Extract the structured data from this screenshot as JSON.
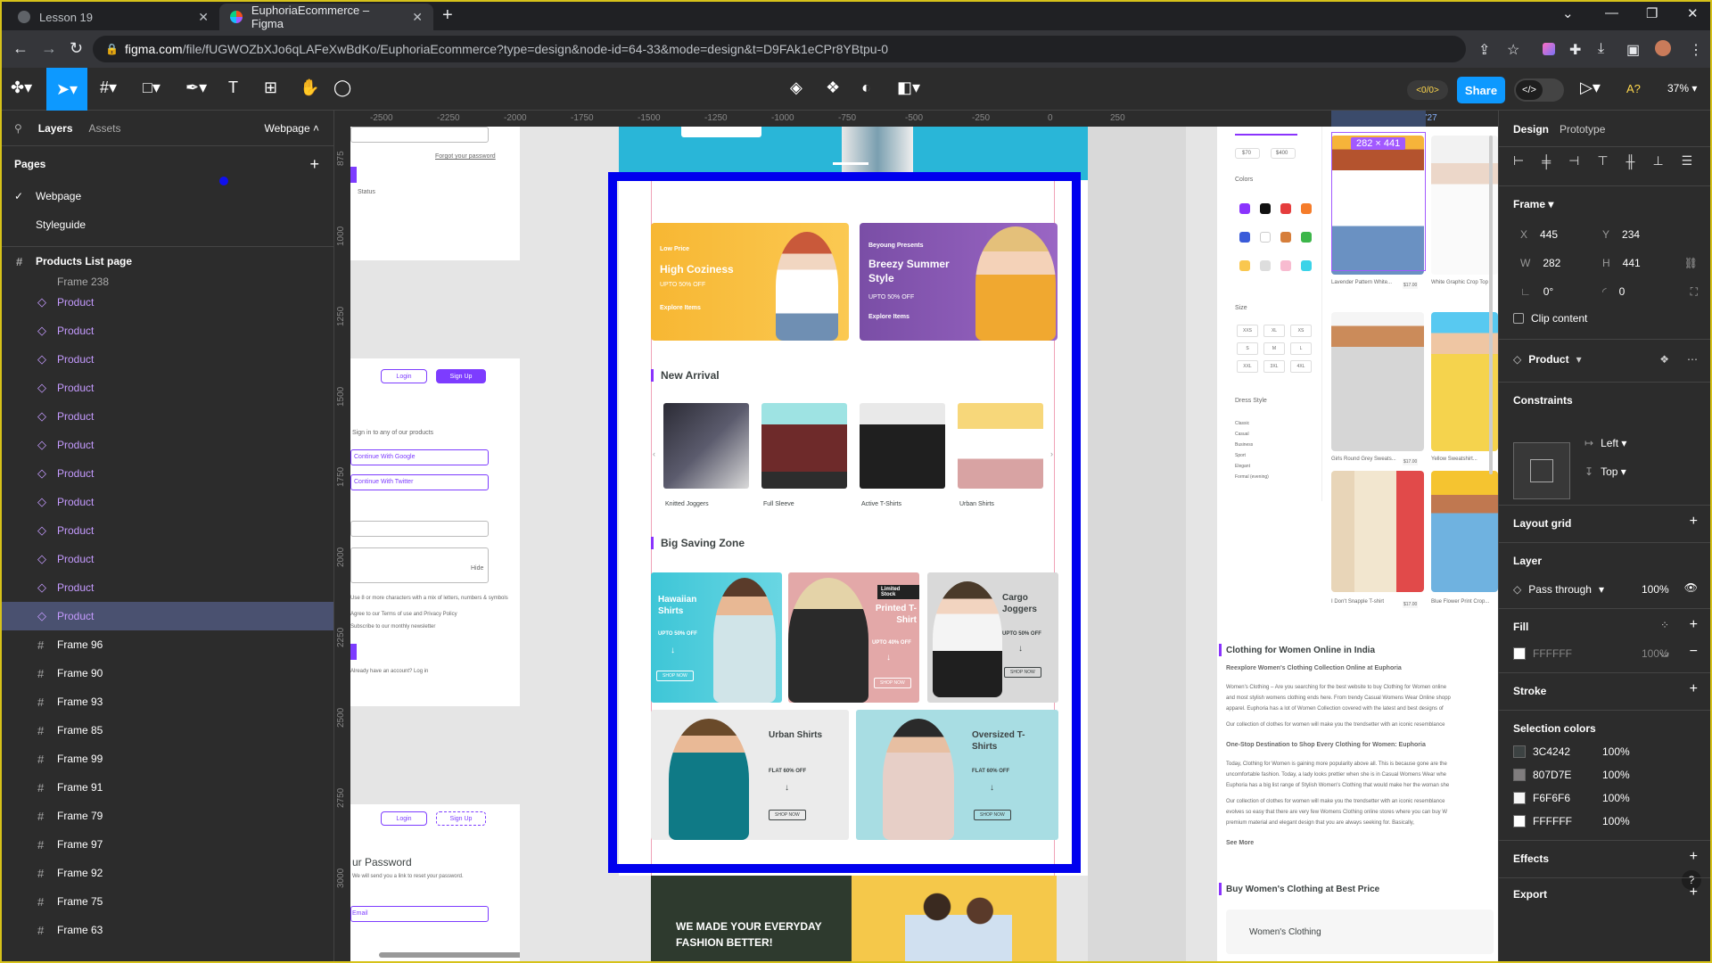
{
  "browser": {
    "tabs": [
      {
        "title": "Lesson 19"
      },
      {
        "title": "EuphoriaEcommerce – Figma"
      }
    ],
    "url_host": "figma.com",
    "url_path": "/file/fUGWOZbXJo6qLAFeXwBdKo/EuphoriaEcommerce?type=design&node-id=64-33&mode=design&t=D9FAk1eCPr8YBtpu-0"
  },
  "toolbar": {
    "share_label": "Share",
    "zoom": "37%",
    "multiplayer_label": "<0/0>",
    "code_label": "</>"
  },
  "left_panel": {
    "tabs": [
      "Layers",
      "Assets"
    ],
    "page_selector": "Webpage",
    "pages_heading": "Pages",
    "pages": [
      {
        "name": "Webpage",
        "current": true
      },
      {
        "name": "Styleguide",
        "current": false
      }
    ],
    "top_frame": "Products List page",
    "partial_row": "Frame 238",
    "components": [
      "Product",
      "Product",
      "Product",
      "Product",
      "Product",
      "Product",
      "Product",
      "Product",
      "Product",
      "Product",
      "Product",
      "Product"
    ],
    "frames": [
      "Frame 96",
      "Frame 90",
      "Frame 93",
      "Frame 85",
      "Frame 99",
      "Frame 91",
      "Frame 79",
      "Frame 97",
      "Frame 92",
      "Frame 75",
      "Frame 63"
    ]
  },
  "rulers": {
    "top": [
      "-2500",
      "-2250",
      "-2000",
      "-1750",
      "-1500",
      "-1250",
      "-1000",
      "-750",
      "-500",
      "-250",
      "0",
      "250",
      "445",
      "727"
    ],
    "left": [
      "875",
      "1000",
      "1250",
      "1500",
      "1750",
      "2000",
      "2250",
      "2500",
      "2750",
      "3000"
    ]
  },
  "canvas": {
    "left_frames": {
      "forgot_link": "Forgot your password",
      "status": "Status",
      "login": "Login",
      "signup": "Sign Up",
      "any_products": "Sign in to any of our products",
      "google": "Continue With Google",
      "twitter": "Continue With Twitter",
      "hide": "Hide",
      "rules": "Use 8 or more characters with a mix of letters, numbers & symbols",
      "terms": "Agree to our Terms of use and Privacy Policy",
      "newsletter": "Subscribe to our monthly newsletter",
      "already": "Already have an account? Log in",
      "login2": "Login",
      "signup2": "Sign Up",
      "reset_title": "ur Password",
      "reset_sub": "We will send you a link to reset your password.",
      "reset_email": "Email"
    },
    "webpage": {
      "promo1": {
        "small": "Low Price",
        "title": "High Coziness",
        "sub": "UPTO 50% OFF",
        "link": "Explore Items"
      },
      "promo2": {
        "small": "Beyoung Presents",
        "title": "Breezy Summer Style",
        "sub": "UPTO 50% OFF",
        "link": "Explore Items"
      },
      "new_arrival": "New Arrival",
      "arrivals": [
        "Knitted Joggers",
        "Full Sleeve",
        "Active T-Shirts",
        "Urban Shirts"
      ],
      "big_saving": "Big Saving Zone",
      "deals": [
        {
          "title": "Hawaiian Shirts",
          "sub": "UPTO 50% OFF",
          "btn": "SHOP NOW"
        },
        {
          "title": "Printed T-Shirt",
          "sub": "UPTO 40% OFF",
          "btn": "SHOP NOW",
          "tag": "Limited Stock"
        },
        {
          "title": "Cargo Joggers",
          "sub": "UPTO 50% OFF",
          "btn": "SHOP NOW"
        },
        {
          "title": "Urban Shirts",
          "sub": "FLAT 60% OFF",
          "btn": "SHOP NOW"
        },
        {
          "title": "Oversized T-Shirts",
          "sub": "FLAT 60% OFF",
          "btn": "SHOP NOW"
        }
      ],
      "banner_text": "WE MADE YOUR EVERYDAY FASHION BETTER!"
    },
    "listing": {
      "selection_size": "282 × 441",
      "price_min": "$70",
      "price_max": "$400",
      "colors_label": "Colors",
      "color_names": [
        "Purple",
        "Black",
        "Red",
        "Orange",
        "Navy",
        "White",
        "Brown",
        "Green",
        "Yellow",
        "Grey",
        "Pink",
        "Blue"
      ],
      "size_label": "Size",
      "sizes": [
        "XXS",
        "XL",
        "XS",
        "S",
        "M",
        "L",
        "XXL",
        "3XL",
        "4XL"
      ],
      "dress_style": "Dress Style",
      "styles": [
        "Classic",
        "Casual",
        "Business",
        "Sport",
        "Elegant",
        "Formal (evening)"
      ],
      "products": [
        {
          "name": "Lavender Pattern White...",
          "brand": "Jhanvi's Brand",
          "price": "$17.00"
        },
        {
          "name": "White Graphic Crop Top",
          "brand": "Jhanvi's Brand",
          "price": ""
        },
        {
          "name": "Girls Round Grey Sweats...",
          "brand": "Jhanvi's Brand",
          "price": "$17.00"
        },
        {
          "name": "Yellow Sweatshirt...",
          "brand": "Jhanvi's Brand",
          "price": ""
        },
        {
          "name": "I Don't Snapple T-shirt",
          "brand": "Jhanvi's Brand",
          "price": "$17.00"
        },
        {
          "name": "Blue Flower Print Crop...",
          "brand": "Jhanvi's Brand",
          "price": ""
        }
      ],
      "seo_title": "Clothing for Women Online in India",
      "seo_sub": "Reexplore Women's Clothing Collection Online at Euphoria",
      "seo_para1": "Women's Clothing – Are you searching for the best website to buy Clothing for Women online",
      "seo_para1b": "and most stylish womens clothing ends here. From trendy Casual Womens Wear Online shopp",
      "seo_para1c": "apparel. Euphoria has a lot of Women Collection covered with the latest and best designs of",
      "seo_para2": "Our collection of clothes for women will make you the trendsetter with an iconic resemblance",
      "seo_h2": "One-Stop Destination to Shop Every Clothing for Women: Euphoria",
      "seo_para3": "Today, Clothing for Women is gaining more popularity above all. This is because gone are the",
      "seo_para3b": "uncomfortable fashion. Today, a lady looks prettier when she is in Casual Womens Wear whe",
      "seo_para3c": "Euphoria has a big list range of Stylish Women's Clothing that would make her the woman she",
      "seo_para4": "Our collection of clothes for women will make you the trendsetter with an iconic resemblance",
      "seo_para4b": "evolves so easy that there are very few Womens Clothing online stores where you can buy W",
      "seo_para4c": "premium material and elegant design that you are always seeking for. Basically,",
      "see_more": "See More",
      "buy_title": "Buy Women's Clothing at Best Price",
      "womens_clothing": "Women's Clothing"
    }
  },
  "right_panel": {
    "tabs": [
      "Design",
      "Prototype"
    ],
    "frame_label": "Frame",
    "x": "445",
    "y": "234",
    "w": "282",
    "h": "441",
    "rotation": "0°",
    "radius": "0",
    "clip_content": "Clip content",
    "component_name": "Product",
    "constraints": "Constraints",
    "constraint_h": "Left",
    "constraint_v": "Top",
    "layout_grid": "Layout grid",
    "layer": "Layer",
    "blend": "Pass through",
    "opacity": "100%",
    "fill": "Fill",
    "fill_hex": "FFFFFF",
    "fill_opacity": "100%",
    "stroke": "Stroke",
    "selection_colors": "Selection colors",
    "colors": [
      {
        "hex": "3C4242",
        "opacity": "100%",
        "swatch": "#3C4242"
      },
      {
        "hex": "807D7E",
        "opacity": "100%",
        "swatch": "#807D7E"
      },
      {
        "hex": "F6F6F6",
        "opacity": "100%",
        "swatch": "#F6F6F6"
      },
      {
        "hex": "FFFFFF",
        "opacity": "100%",
        "swatch": "#FFFFFF"
      }
    ],
    "effects": "Effects",
    "export": "Export"
  }
}
